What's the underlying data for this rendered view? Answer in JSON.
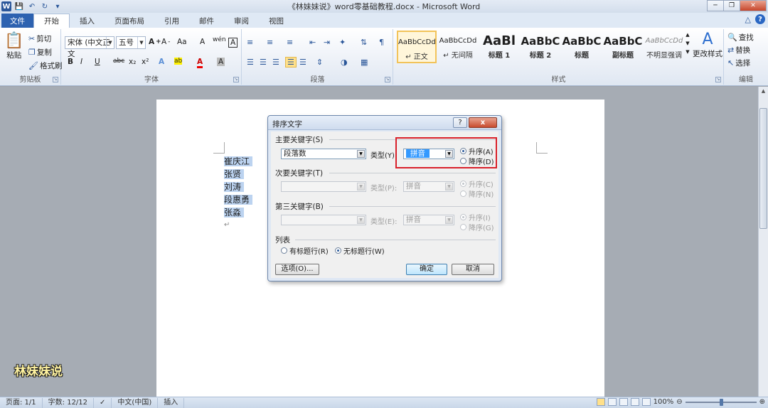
{
  "window": {
    "title": "《林妹妹说》word零基础教程.docx - Microsoft Word",
    "word_icon": "W"
  },
  "tabs": [
    "文件",
    "开始",
    "插入",
    "页面布局",
    "引用",
    "邮件",
    "审阅",
    "视图"
  ],
  "ribbon": {
    "clipboard": {
      "label": "剪贴板",
      "paste": "粘贴",
      "cut": "剪切",
      "copy": "复制",
      "format_painter": "格式刷"
    },
    "font": {
      "label": "字体",
      "font_name": "宋体 (中文正文",
      "font_size": "五号",
      "bold": "B",
      "italic": "I",
      "underline": "U",
      "strike": "abc",
      "sub": "x₂",
      "sup": "x²",
      "grow": "A",
      "shrink": "A",
      "case": "Aa",
      "clear": "A",
      "phonetic": "wén",
      "border_char": "A",
      "shade_char": "A",
      "effect": "A",
      "highlight": "ab",
      "font_color": "A"
    },
    "paragraph": {
      "label": "段落"
    },
    "styles": {
      "label": "样式",
      "items": [
        {
          "sample": "AaBbCcDd",
          "name": "↵ 正文"
        },
        {
          "sample": "AaBbCcDd",
          "name": "↵ 无间隔"
        },
        {
          "sample": "AaBl",
          "name": "标题 1"
        },
        {
          "sample": "AaBbC",
          "name": "标题 2"
        },
        {
          "sample": "AaBbC",
          "name": "标题"
        },
        {
          "sample": "AaBbC",
          "name": "副标题"
        },
        {
          "sample": "AaBbCcDd",
          "name": "不明显强调"
        }
      ],
      "change_styles": "更改样式"
    },
    "editing": {
      "label": "编辑",
      "find": "查找",
      "replace": "替换",
      "select": "选择"
    }
  },
  "document": {
    "lines": [
      "崔庆江",
      "张贤",
      "刘涛",
      "段惠勇",
      "张淼"
    ],
    "para_mark": "↵"
  },
  "dialog": {
    "title": "排序文字",
    "help": "?",
    "close": "x",
    "primary": {
      "section": "主要关键字(S)",
      "field": "段落数",
      "type_label": "类型(Y):",
      "type_value": "拼音",
      "asc": "升序(A)",
      "desc": "降序(D)"
    },
    "secondary": {
      "section": "次要关键字(T)",
      "field": "",
      "type_label": "类型(P):",
      "type_value": "拼音",
      "asc": "升序(C)",
      "desc": "降序(N)"
    },
    "tertiary": {
      "section": "第三关键字(B)",
      "field": "",
      "type_label": "类型(E):",
      "type_value": "拼音",
      "asc": "升序(I)",
      "desc": "降序(G)"
    },
    "list": {
      "section": "列表",
      "has_header": "有标题行(R)",
      "no_header": "无标题行(W)"
    },
    "options_btn": "选项(O)...",
    "ok_btn": "确定",
    "cancel_btn": "取消"
  },
  "status": {
    "page": "页面: 1/1",
    "words": "字数: 12/12",
    "lang": "中文(中国)",
    "mode": "插入",
    "zoom": "100%",
    "zoom_fraction": 0.5
  },
  "watermark": "林妹妹说"
}
